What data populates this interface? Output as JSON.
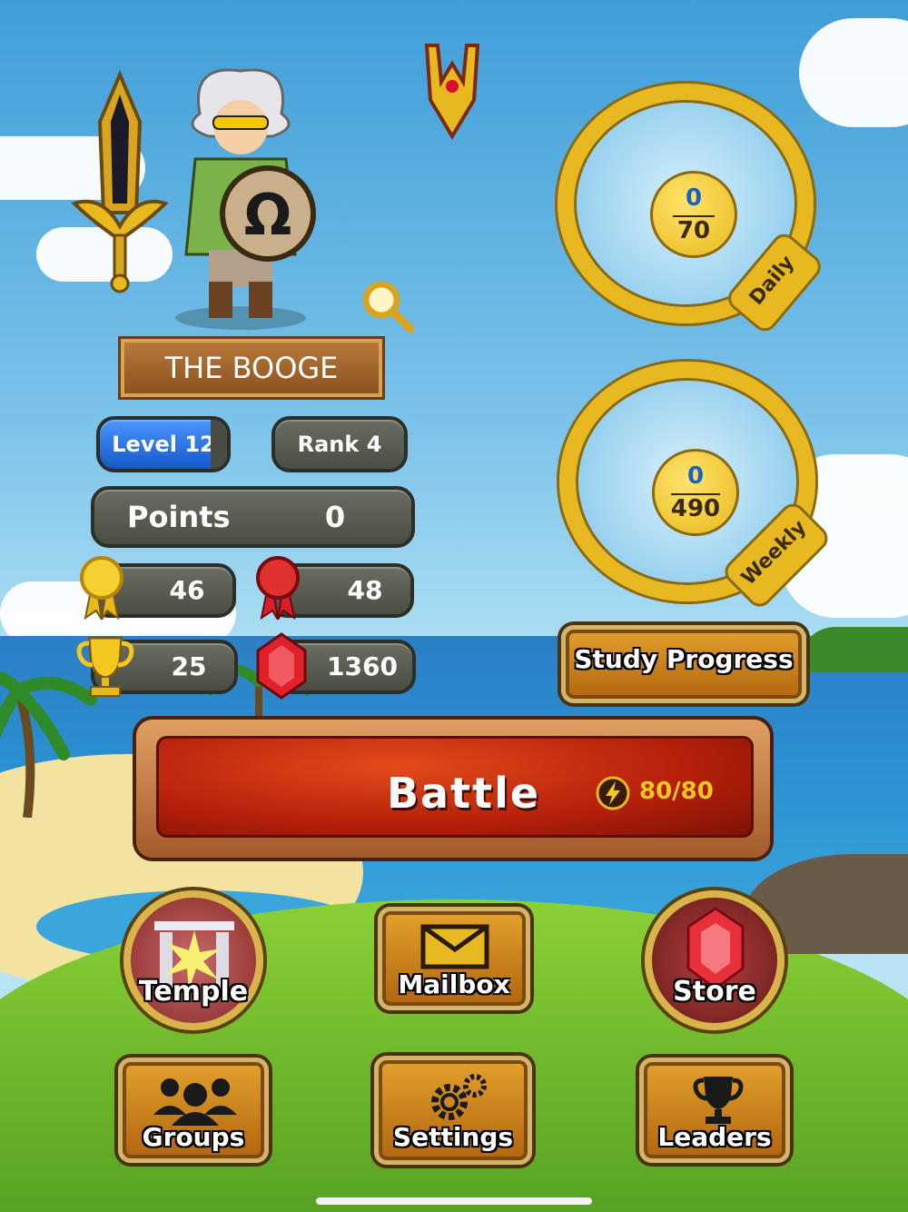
{
  "player": {
    "name": "THE BOOGE",
    "level": "Level 12",
    "rank": "Rank 4",
    "points_label": "Points",
    "points_value": "0",
    "level_progress": 0.87
  },
  "stats": {
    "gold_medals": "46",
    "red_ribbons": "48",
    "trophies": "25",
    "gems": "1360"
  },
  "goals": {
    "daily": {
      "current": "0",
      "target": "70",
      "label": "Daily"
    },
    "weekly": {
      "current": "0",
      "target": "490",
      "label": "Weekly"
    }
  },
  "buttons": {
    "study_progress": "Study Progress",
    "battle": "Battle",
    "energy": "80/80",
    "temple": "Temple",
    "mailbox": "Mailbox",
    "store": "Store",
    "groups": "Groups",
    "settings": "Settings",
    "leaders": "Leaders"
  },
  "icons": {
    "emblem": "crest-icon",
    "inspect": "magnifier-icon",
    "energy": "lightning-icon"
  },
  "colors": {
    "gold": "#e8b820",
    "battle_red": "#c42810",
    "level_blue": "#1f6fe0"
  }
}
